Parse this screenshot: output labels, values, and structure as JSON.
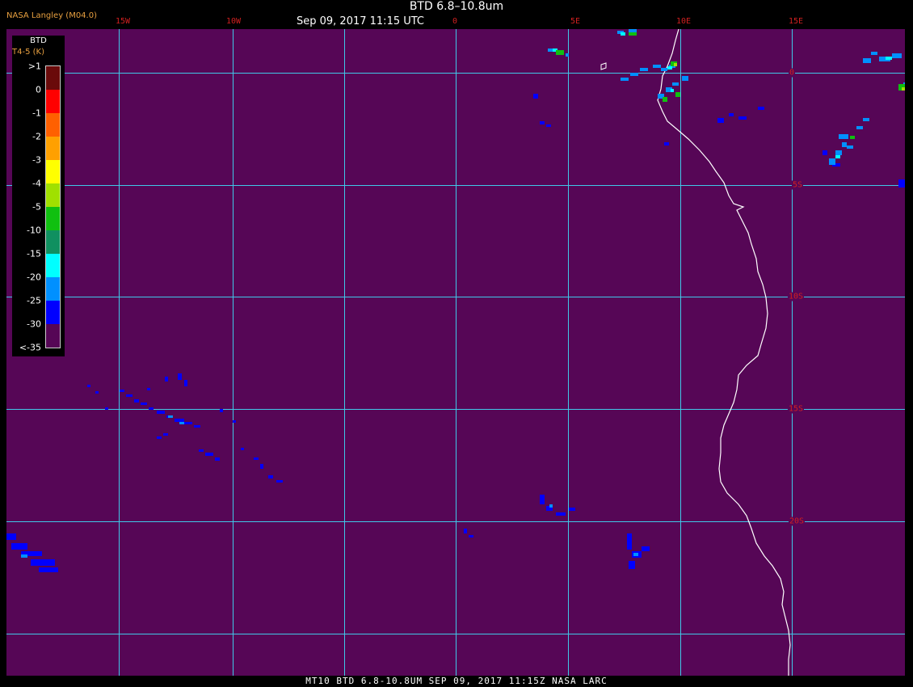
{
  "header": {
    "title": "BTD 6.8–10.8um",
    "time": "Sep 09, 2017 11:15 UTC",
    "producer": "NASA Langley (M04.0)"
  },
  "legend": {
    "title": "BTD",
    "units": "T4-5 (K)",
    "ticks": [
      ">1",
      "0",
      "-1",
      "-2",
      "-3",
      "-4",
      "-5",
      "-10",
      "-15",
      "-20",
      "-25",
      "-30",
      "<-35"
    ],
    "colors": [
      "#6a0a0a",
      "#ff0000",
      "#ff6000",
      "#ffa000",
      "#ffff00",
      "#a0e000",
      "#10c010",
      "#109060",
      "#00ffff",
      "#0090ff",
      "#0000ff",
      "#560656"
    ]
  },
  "grid": {
    "lon_labels": [
      "15W",
      "10W",
      "0",
      "5E",
      "10E",
      "15E"
    ],
    "lat_labels": [
      "0",
      "5S",
      "10S",
      "15S",
      "20S"
    ]
  },
  "colors": {
    "background": "#560656",
    "grid_line": "#40c8e8",
    "coastline": "#ffffff",
    "label": "#d02020"
  },
  "footer": {
    "text": "MT10  BTD 6.8-10.8UM   SEP 09, 2017 11:15Z   NASA LARC"
  }
}
